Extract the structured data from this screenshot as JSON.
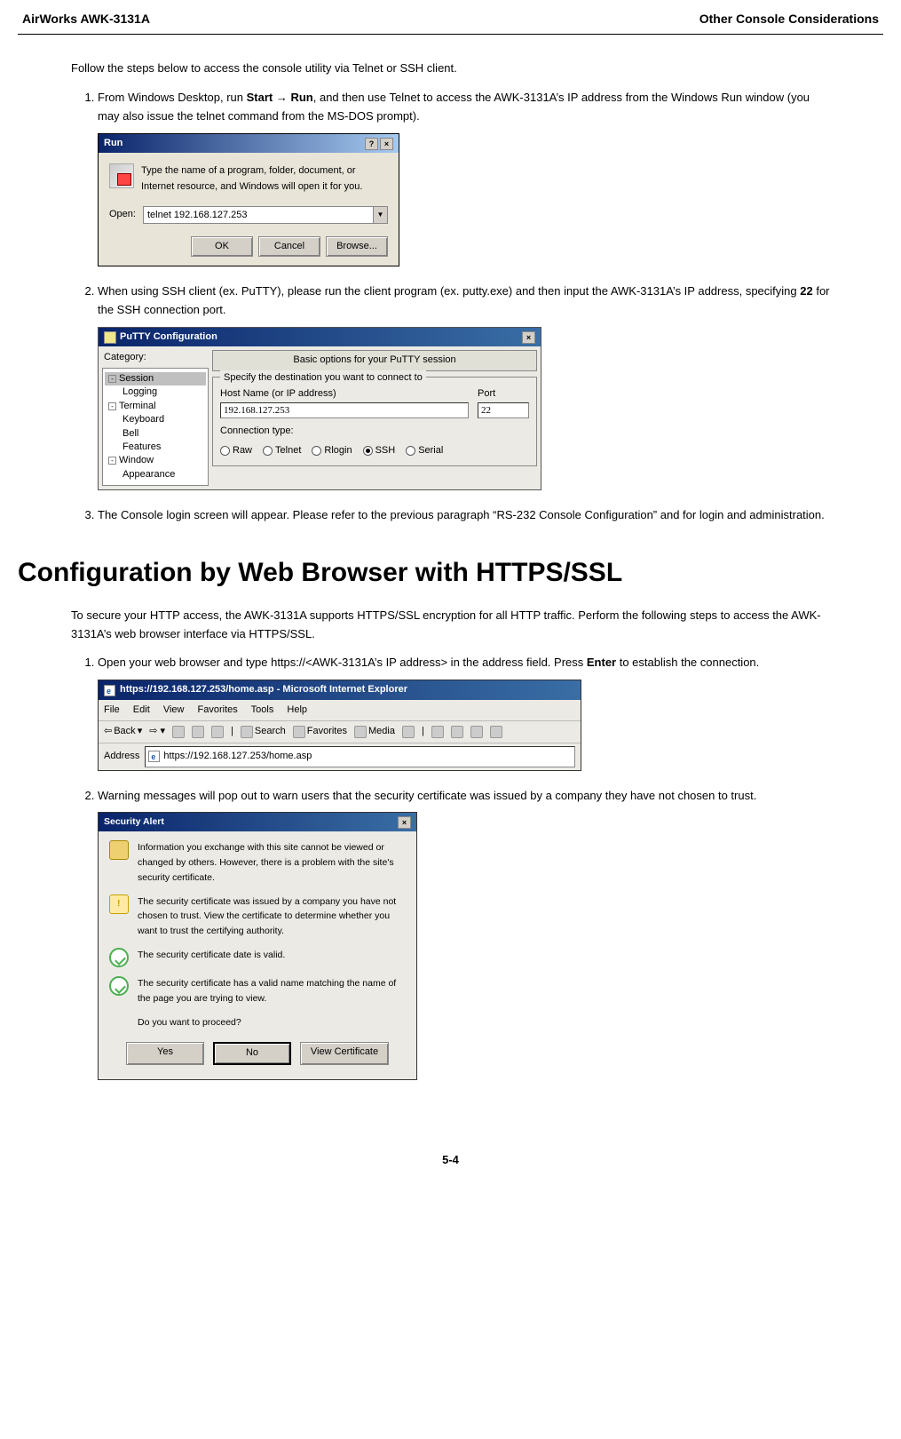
{
  "header": {
    "left": "AirWorks AWK-3131A",
    "right": "Other Console Considerations"
  },
  "intro": "Follow the steps below to access the console utility via Telnet or SSH client.",
  "step1": {
    "pre": "From Windows Desktop, run ",
    "bold1": "Start → Run",
    "post": ", and then use Telnet to access the AWK-3131A’s IP address from the Windows Run window (you may also issue the telnet command from the MS-DOS prompt)."
  },
  "step2": {
    "pre": "When using SSH client (ex. PuTTY), please run the client program (ex. putty.exe) and then input the AWK-3131A’s IP address, specifying ",
    "bold": "22",
    "post": " for the SSH connection port."
  },
  "step3": "The Console login screen will appear. Please refer to the previous paragraph “RS-232 Console Configuration” and for login and administration.",
  "run": {
    "title": "Run",
    "desc": "Type the name of a program, folder, document, or Internet resource, and Windows will open it for you.",
    "open_label": "Open:",
    "value": "telnet 192.168.127.253",
    "ok": "OK",
    "cancel": "Cancel",
    "browse": "Browse..."
  },
  "putty": {
    "title": "PuTTY Configuration",
    "category": "Category:",
    "tree": {
      "session": "Session",
      "logging": "Logging",
      "terminal": "Terminal",
      "keyboard": "Keyboard",
      "bell": "Bell",
      "features": "Features",
      "window": "Window",
      "appearance": "Appearance"
    },
    "banner": "Basic options for your PuTTY session",
    "legend": "Specify the destination you want to connect to",
    "host_label": "Host Name (or IP address)",
    "port_label": "Port",
    "host": "192.168.127.253",
    "port": "22",
    "conn_label": "Connection type:",
    "raw": "Raw",
    "telnet": "Telnet",
    "rlogin": "Rlogin",
    "ssh": "SSH",
    "serial": "Serial"
  },
  "h1": "Configuration by Web Browser with HTTPS/SSL",
  "https_intro": "To secure your HTTP access, the AWK-3131A supports HTTPS/SSL encryption for all HTTP traffic. Perform the following steps to access the AWK-3131A’s web browser interface via HTTPS/SSL.",
  "hstep1": {
    "pre": "Open your web browser and type https://<AWK-3131A’s IP address> in the address field. Press ",
    "bold": "Enter",
    "post": " to establish the connection."
  },
  "hstep2": "Warning messages will pop out to warn users that the security certificate was issued by a company they have not chosen to trust.",
  "ie": {
    "title": "https://192.168.127.253/home.asp - Microsoft Internet Explorer",
    "menu": [
      "File",
      "Edit",
      "View",
      "Favorites",
      "Tools",
      "Help"
    ],
    "back": "Back",
    "search": "Search",
    "favorites": "Favorites",
    "media": "Media",
    "addr_label": "Address",
    "url": "https://192.168.127.253/home.asp"
  },
  "sec": {
    "title": "Security Alert",
    "p1": "Information you exchange with this site cannot be viewed or changed by others. However, there is a problem with the site's security certificate.",
    "p2": "The security certificate was issued by a company you have not chosen to trust. View the certificate to determine whether you want to trust the certifying authority.",
    "p3": "The security certificate date is valid.",
    "p4": "The security certificate has a valid name matching the name of the page you are trying to view.",
    "q": "Do you want to proceed?",
    "yes": "Yes",
    "no": "No",
    "view": "View Certificate"
  },
  "page": "5-4"
}
